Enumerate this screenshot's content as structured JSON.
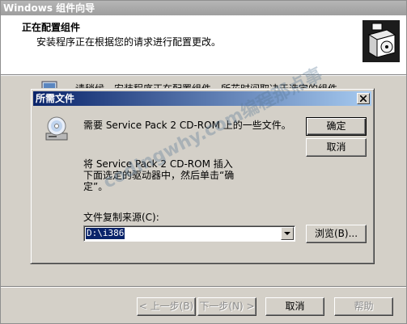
{
  "window": {
    "title": "Windows 组件向导"
  },
  "header": {
    "title": "正在配置组件",
    "subtitle": "安装程序正在根据您的请求进行配置更改。",
    "icon": "setup-box-icon"
  },
  "body": {
    "text": "请稍候，安装程序正在配置组件。所花时间取决于选定的组件。",
    "icon": "computer-icon"
  },
  "wizard_buttons": {
    "back": {
      "label": "< 上一步(B)",
      "disabled": true
    },
    "next": {
      "label": "下一步(N) >",
      "disabled": true
    },
    "cancel": {
      "label": "取消",
      "disabled": false
    },
    "help": {
      "label": "帮助",
      "disabled": true
    }
  },
  "dialog": {
    "title": "所需文件",
    "icon": "cd-drive-icon",
    "message1": "需要 Service Pack 2 CD-ROM 上的一些文件。",
    "message2": "将 Service Pack 2 CD-ROM 插入下面选定的驱动器中，然后单击“确定”。",
    "ok_label": "确定",
    "cancel_label": "取消",
    "source_label": "文件复制来源(C):",
    "source_value": "D:\\i386",
    "browse_label": "浏览(B)..."
  },
  "watermark": {
    "text": "codingwhy.com编程那点事"
  },
  "colors": {
    "face": "#d4d0c8",
    "dialog_title_start": "#0a246a",
    "dialog_title_end": "#a6caf0",
    "selection": "#0a246a",
    "disabled_text": "#8c8c8c"
  }
}
